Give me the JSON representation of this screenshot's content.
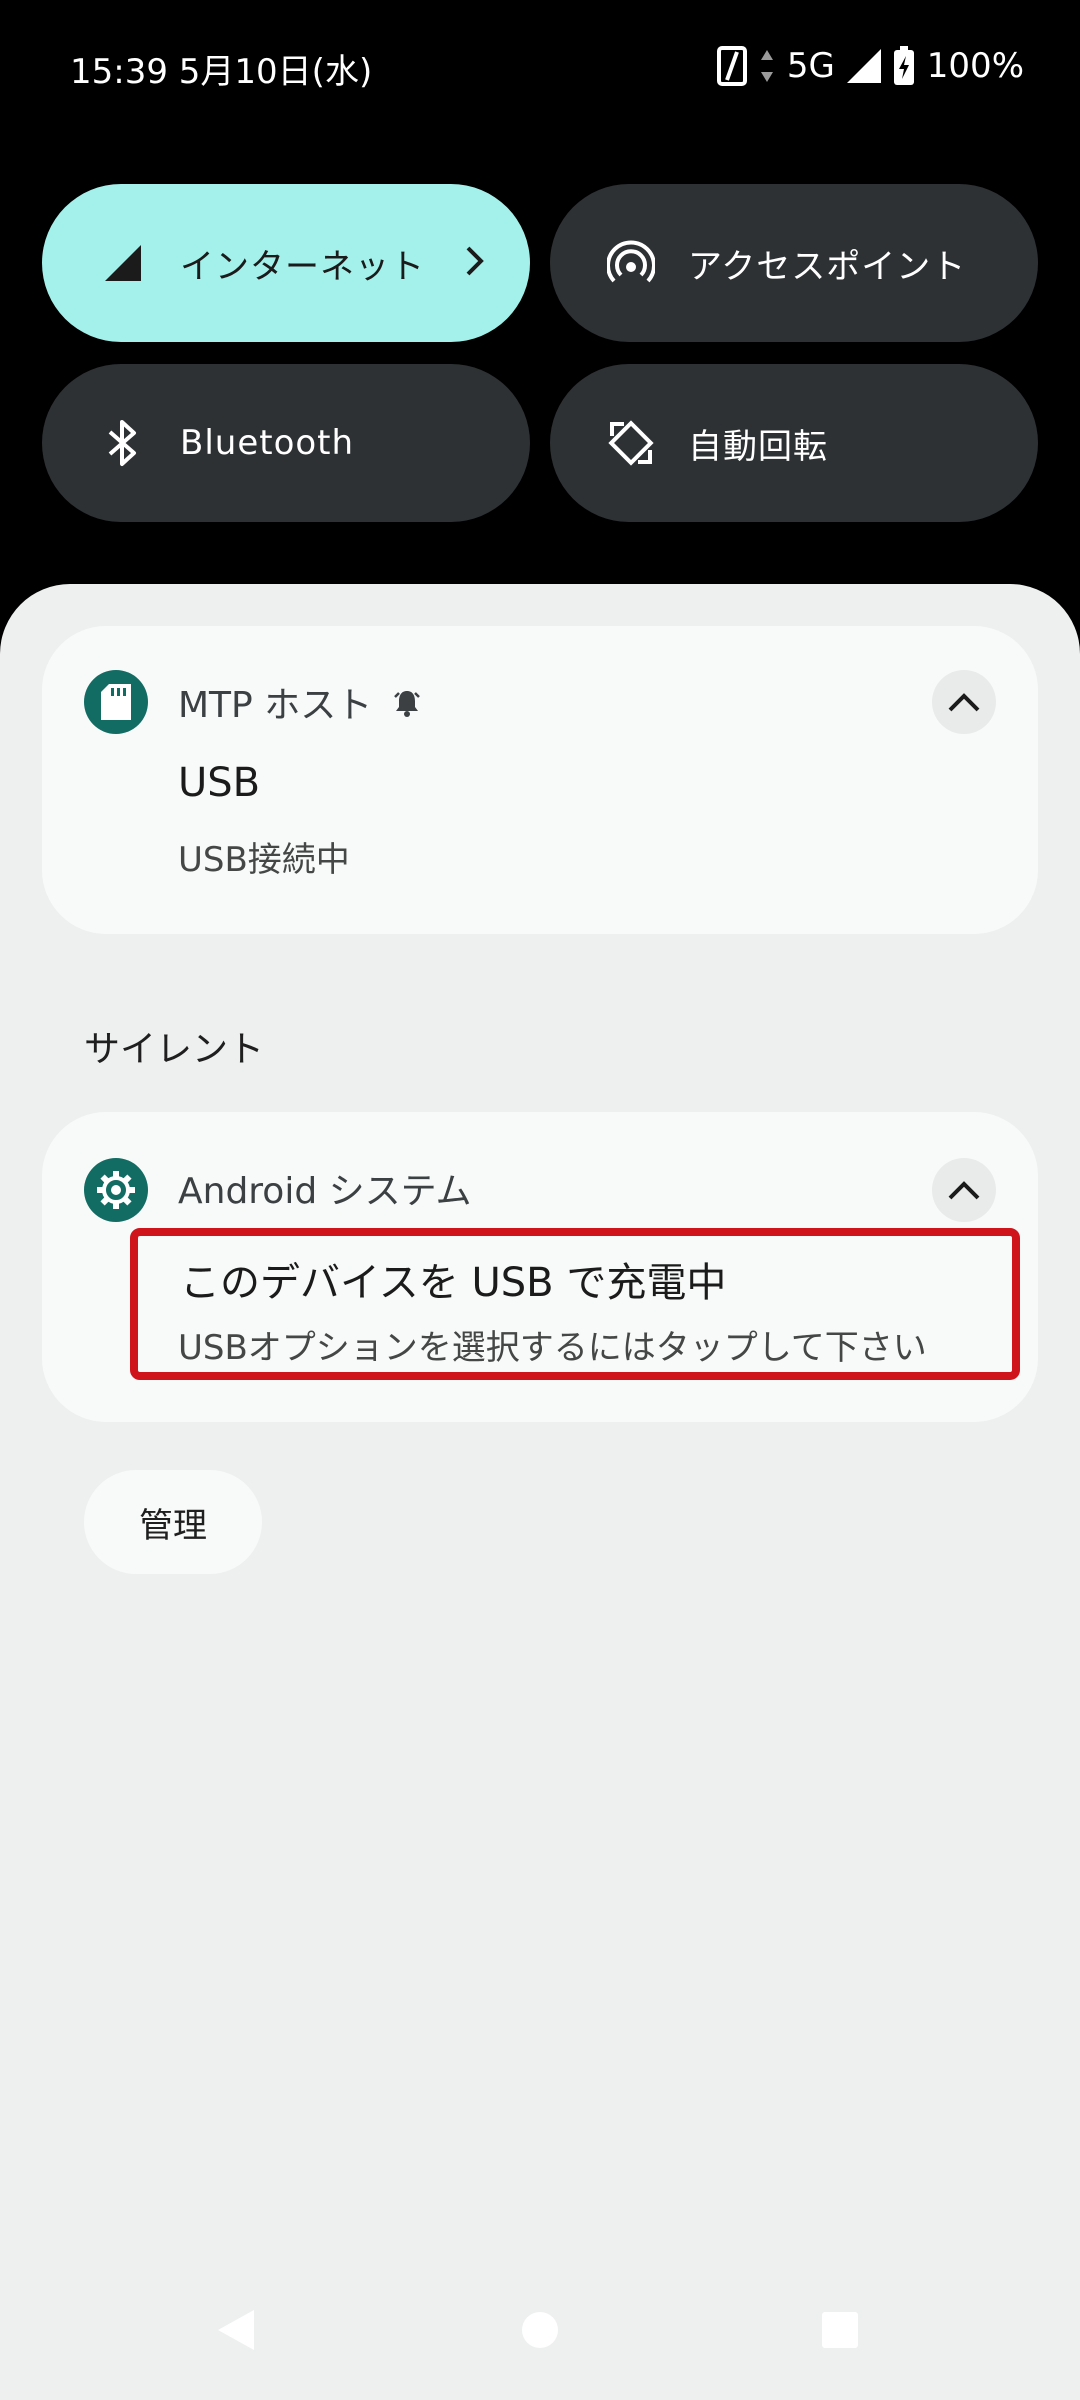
{
  "status_bar": {
    "time_date": "15:39 5月10日(水)",
    "network": "5G",
    "battery": "100%",
    "icons": [
      "nfc-icon",
      "data-arrows-icon",
      "signal-icon",
      "battery-charging-icon"
    ]
  },
  "quick_settings": {
    "tiles": [
      {
        "label": "インターネット",
        "icon": "signal-icon",
        "active": true,
        "has_chevron": true
      },
      {
        "label": "アクセスポイント",
        "icon": "hotspot-icon",
        "active": false
      },
      {
        "label": "Bluetooth",
        "icon": "bluetooth-icon",
        "active": false
      },
      {
        "label": "自動回転",
        "icon": "auto-rotate-icon",
        "active": false
      }
    ],
    "colors": {
      "active": "#a3f1ea",
      "inactive": "#2d3133"
    }
  },
  "notifications": {
    "mtp": {
      "app_name": "MTP ホスト",
      "app_icon": "sd-card-icon",
      "alert_icon": "bell-icon",
      "title": "USB",
      "text": "USB接続中"
    },
    "silent_label": "サイレント",
    "android_system": {
      "app_name": "Android システム",
      "app_icon": "gear-icon",
      "title": "このデバイスを USB で充電中",
      "text": "USBオプションを選択するにはタップして下さい"
    },
    "manage_label": "管理"
  },
  "highlight_color": "#d0141b",
  "nav_bar": {
    "buttons": [
      "back-icon",
      "home-icon",
      "recents-icon"
    ]
  }
}
